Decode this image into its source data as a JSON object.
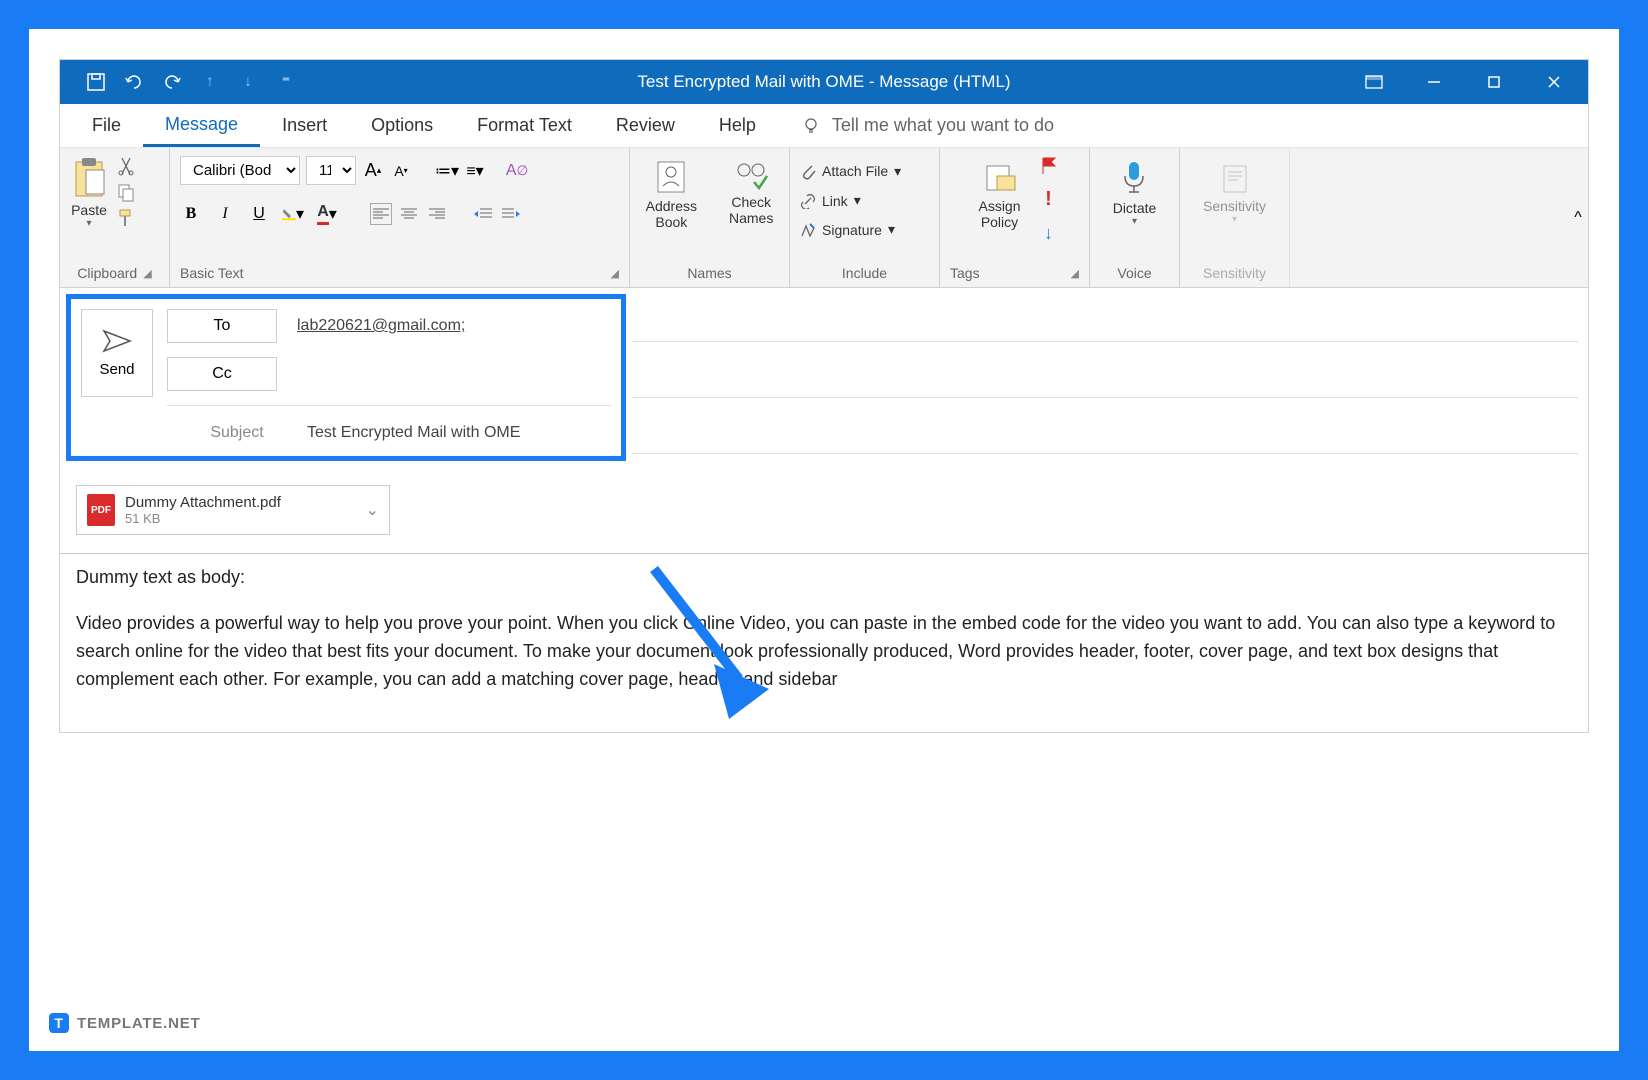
{
  "titleBar": {
    "title": "Test Encrypted Mail with OME  -  Message (HTML)"
  },
  "menu": {
    "file": "File",
    "message": "Message",
    "insert": "Insert",
    "options": "Options",
    "formatText": "Format Text",
    "review": "Review",
    "help": "Help",
    "tellMe": "Tell me what you want to do"
  },
  "ribbon": {
    "clipboard": {
      "paste": "Paste",
      "label": "Clipboard"
    },
    "basicText": {
      "fontName": "Calibri (Bod",
      "fontSize": "11",
      "label": "Basic Text"
    },
    "names": {
      "addressBook": "Address\nBook",
      "checkNames": "Check\nNames",
      "label": "Names"
    },
    "include": {
      "attachFile": "Attach File",
      "link": "Link",
      "signature": "Signature",
      "label": "Include"
    },
    "tags": {
      "assignPolicy": "Assign\nPolicy",
      "label": "Tags"
    },
    "voice": {
      "dictate": "Dictate",
      "label": "Voice"
    },
    "sensitivity": {
      "sensitivity": "Sensitivity",
      "label": "Sensitivity"
    }
  },
  "compose": {
    "send": "Send",
    "to": "To",
    "toValue": "lab220621@gmail.com;",
    "cc": "Cc",
    "ccValue": "",
    "subjectLabel": "Subject",
    "subjectValue": "Test Encrypted Mail with OME"
  },
  "attachment": {
    "name": "Dummy Attachment.pdf",
    "size": "51 KB",
    "iconText": "PDF"
  },
  "body": {
    "intro": "Dummy text as body:",
    "para": "Video provides a powerful way to help you prove your point. When you click Online Video, you can paste in the embed code for the video you want to add. You can also type a keyword to search online for the video that best fits your document. To make your document look professionally produced, Word provides header, footer, cover page, and text box designs that complement each other. For example, you can add a matching cover page, header, and sidebar"
  },
  "watermark": "TEMPLATE.NET"
}
